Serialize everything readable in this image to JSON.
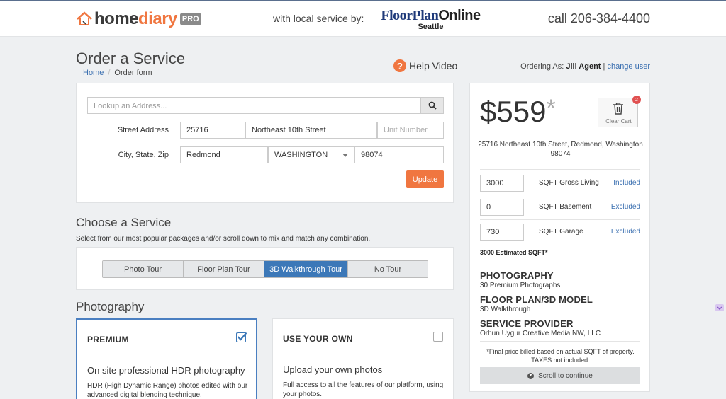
{
  "header": {
    "logo_home": "home",
    "logo_diary": "diary",
    "logo_pro": "PRO",
    "service_by": "with local service by:",
    "partner_brand_a": "FloorPlan",
    "partner_brand_b": "Online",
    "partner_city": "Seattle",
    "phone": "call 206-384-4400"
  },
  "page": {
    "title": "Order a Service",
    "breadcrumb_home": "Home",
    "breadcrumb_sep": "/",
    "breadcrumb_current": "Order form",
    "help_label": "Help Video",
    "help_glyph": "?",
    "ordering_prefix": "Ordering As:",
    "ordering_user": "Jill Agent",
    "ordering_sep": "|",
    "ordering_change": "change user"
  },
  "address": {
    "lookup_placeholder": "Lookup an Address...",
    "street_label": "Street Address",
    "street_number": "25716",
    "street_name": "Northeast 10th Street",
    "unit_placeholder": "Unit Number",
    "city_label": "City, State, Zip",
    "city": "Redmond",
    "state": "WASHINGTON",
    "zip": "98074",
    "update_label": "Update"
  },
  "service": {
    "title": "Choose a Service",
    "subtitle": "Select from our most popular packages and/or scroll down to mix and match any combination.",
    "tabs": [
      {
        "label": "Photo Tour",
        "active": false
      },
      {
        "label": "Floor Plan Tour",
        "active": false
      },
      {
        "label": "3D Walkthrough Tour",
        "active": true
      },
      {
        "label": "No Tour",
        "active": false
      }
    ]
  },
  "photography": {
    "title": "Photography",
    "options": [
      {
        "name": "PREMIUM",
        "checked": true,
        "headline": "On site professional HDR photography",
        "description": "HDR (High Dynamic Range) photos edited with our advanced digital blending technique."
      },
      {
        "name": "USE YOUR OWN",
        "checked": false,
        "headline": "Upload your own photos",
        "description": "Full access to all the features of our platform, using your photos."
      }
    ]
  },
  "cart": {
    "price": "$559",
    "price_star": "*",
    "clear_label": "Clear Cart",
    "badge_count": "2",
    "address": "25716 Northeast 10th Street, Redmond, Washington 98074",
    "sqft_rows": [
      {
        "value": "3000",
        "label": "SQFT Gross Living",
        "status": "Included"
      },
      {
        "value": "0",
        "label": "SQFT Basement",
        "status": "Excluded"
      },
      {
        "value": "730",
        "label": "SQFT Garage",
        "status": "Excluded"
      }
    ],
    "estimated": "3000 Estimated SQFT*",
    "summary": [
      {
        "title": "PHOTOGRAPHY",
        "value": "30 Premium Photographs"
      },
      {
        "title": "FLOOR PLAN/3D MODEL",
        "value": "3D Walkthrough"
      },
      {
        "title": "SERVICE PROVIDER",
        "value": "Orhun Uygur Creative Media NW, LLC"
      }
    ],
    "fine_print": "*Final price billed based on actual SQFT of property. TAXES not included.",
    "scroll_label": "Scroll to continue"
  },
  "colors": {
    "accent": "#f07640",
    "primary": "#3c78b8",
    "link": "#3a6fb0"
  }
}
